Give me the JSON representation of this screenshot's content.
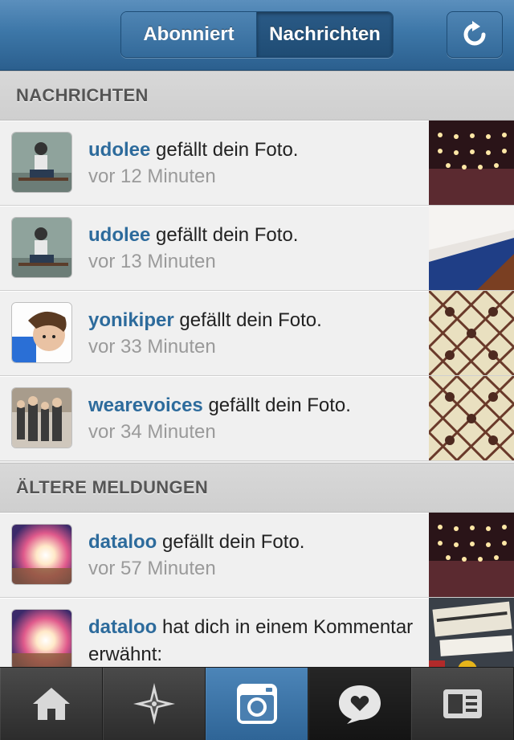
{
  "header": {
    "segments": [
      "Abonniert",
      "Nachrichten"
    ],
    "selected_segment": "Nachrichten",
    "refresh_icon": "refresh-icon"
  },
  "sections": [
    {
      "title": "NACHRICHTEN",
      "items": [
        {
          "user": "udolee",
          "text": "gefällt dein Foto.",
          "time": "vor 12 Minuten"
        },
        {
          "user": "udolee",
          "text": "gefällt dein Foto.",
          "time": "vor 13 Minuten"
        },
        {
          "user": "yonikiper",
          "text": "gefällt dein Foto.",
          "time": "vor 33 Minuten"
        },
        {
          "user": "wearevoices",
          "text": "gefällt dein Foto.",
          "time": "vor 34 Minuten"
        }
      ]
    },
    {
      "title": "ÄLTERE MELDUNGEN",
      "items": [
        {
          "user": "dataloo",
          "text": "gefällt dein Foto.",
          "time": "vor 57 Minuten"
        },
        {
          "user": "dataloo",
          "text": "hat dich in einem Kommentar erwähnt:",
          "time": ""
        }
      ]
    }
  ],
  "tabbar": {
    "tabs": [
      "home-icon",
      "explore-icon",
      "camera-icon",
      "news-icon",
      "profile-icon"
    ],
    "active": "camera-icon"
  },
  "colors": {
    "header_blue": "#3d77a8",
    "username_blue": "#2d6b9c",
    "time_gray": "#9a9a9a"
  }
}
